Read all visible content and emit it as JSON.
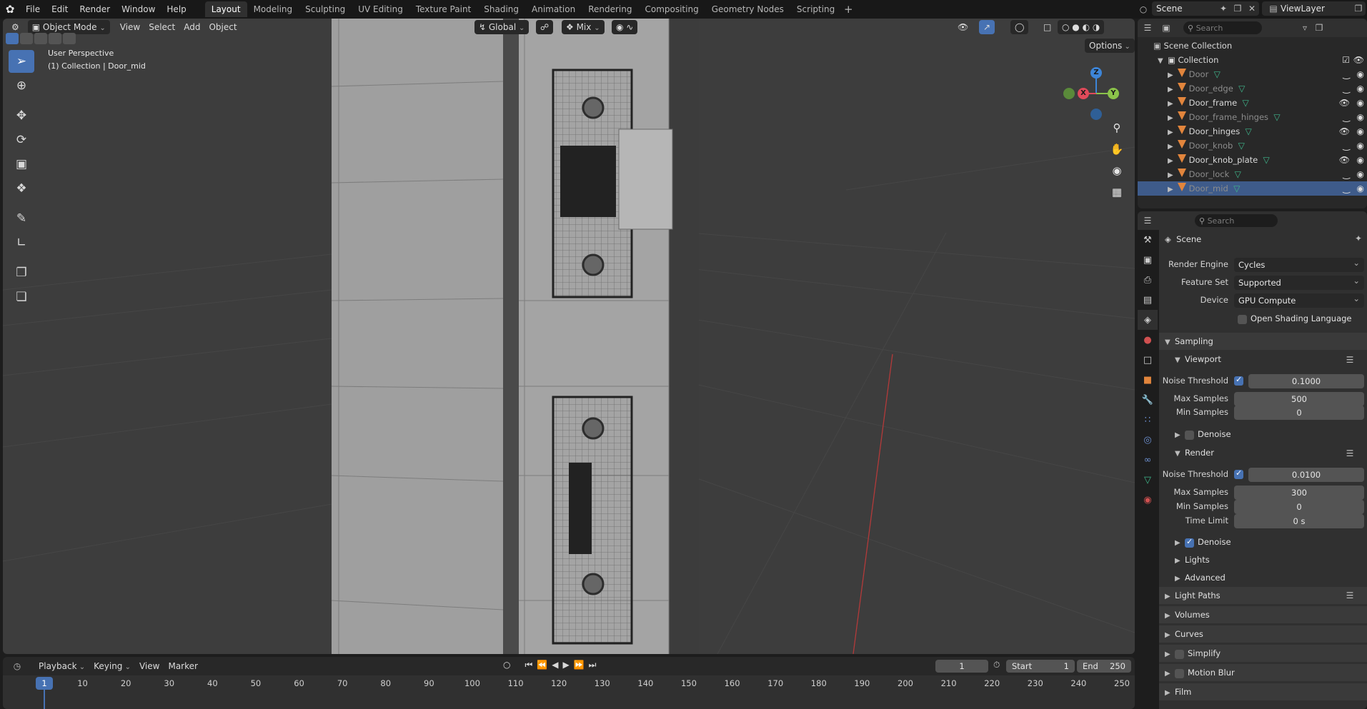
{
  "topbar": {
    "menus": [
      "File",
      "Edit",
      "Render",
      "Window",
      "Help"
    ],
    "workspaces": [
      "Layout",
      "Modeling",
      "Sculpting",
      "UV Editing",
      "Texture Paint",
      "Shading",
      "Animation",
      "Rendering",
      "Compositing",
      "Geometry Nodes",
      "Scripting"
    ],
    "active_workspace": "Layout",
    "add_workspace": "+",
    "scene_name": "Scene",
    "view_layer": "ViewLayer"
  },
  "viewport": {
    "mode": "Object Mode",
    "menus": [
      "View",
      "Select",
      "Add",
      "Object"
    ],
    "transform_orientation": "Global",
    "snap_label": "Mix",
    "options_label": "Options",
    "overlay_title": "User Perspective",
    "overlay_subtitle": "(1) Collection | Door_mid",
    "gizmo": {
      "x": "X",
      "y": "Y",
      "z": "Z"
    }
  },
  "outliner": {
    "search_placeholder": "Search",
    "root": "Scene Collection",
    "collection": "Collection",
    "items": [
      {
        "name": "Door",
        "visible": false
      },
      {
        "name": "Door_edge",
        "visible": false
      },
      {
        "name": "Door_frame",
        "visible": true
      },
      {
        "name": "Door_frame_hinges",
        "visible": false
      },
      {
        "name": "Door_hinges",
        "visible": true
      },
      {
        "name": "Door_knob",
        "visible": false
      },
      {
        "name": "Door_knob_plate",
        "visible": true
      },
      {
        "name": "Door_lock",
        "visible": false
      },
      {
        "name": "Door_mid",
        "visible": false,
        "selected": true
      }
    ]
  },
  "properties": {
    "search_placeholder": "Search",
    "context": "Scene",
    "render_engine_label": "Render Engine",
    "render_engine": "Cycles",
    "feature_set_label": "Feature Set",
    "feature_set": "Supported",
    "device_label": "Device",
    "device": "GPU Compute",
    "osl_label": "Open Shading Language",
    "sampling": "Sampling",
    "viewport": "Viewport",
    "vp_noise_threshold_label": "Noise Threshold",
    "vp_noise_threshold": "0.1000",
    "vp_max_samples_label": "Max Samples",
    "vp_max_samples": "500",
    "vp_min_samples_label": "Min Samples",
    "vp_min_samples": "0",
    "vp_denoise": "Denoise",
    "render": "Render",
    "r_noise_threshold_label": "Noise Threshold",
    "r_noise_threshold": "0.0100",
    "r_max_samples_label": "Max Samples",
    "r_max_samples": "300",
    "r_min_samples_label": "Min Samples",
    "r_min_samples": "0",
    "r_time_limit_label": "Time Limit",
    "r_time_limit": "0 s",
    "r_denoise": "Denoise",
    "lights": "Lights",
    "advanced": "Advanced",
    "light_paths": "Light Paths",
    "volumes": "Volumes",
    "curves": "Curves",
    "simplify": "Simplify",
    "motion_blur": "Motion Blur",
    "film": "Film"
  },
  "timeline": {
    "menus": [
      "Playback",
      "Keying",
      "View",
      "Marker"
    ],
    "current_frame": "1",
    "start_label": "Start",
    "start": "1",
    "end_label": "End",
    "end": "250",
    "ruler": [
      "1",
      "10",
      "20",
      "30",
      "40",
      "50",
      "60",
      "70",
      "80",
      "90",
      "100",
      "110",
      "120",
      "130",
      "140",
      "150",
      "160",
      "170",
      "180",
      "190",
      "200",
      "210",
      "220",
      "230",
      "240",
      "250"
    ]
  },
  "colors": {
    "accent": "#4772b3",
    "selection": "#3e5b8a",
    "object_icon": "#e2853c",
    "mesh_icon": "#3fb68b",
    "axis_x": "#e04a5a",
    "axis_y": "#8bc34a",
    "axis_z": "#3d85d8"
  }
}
